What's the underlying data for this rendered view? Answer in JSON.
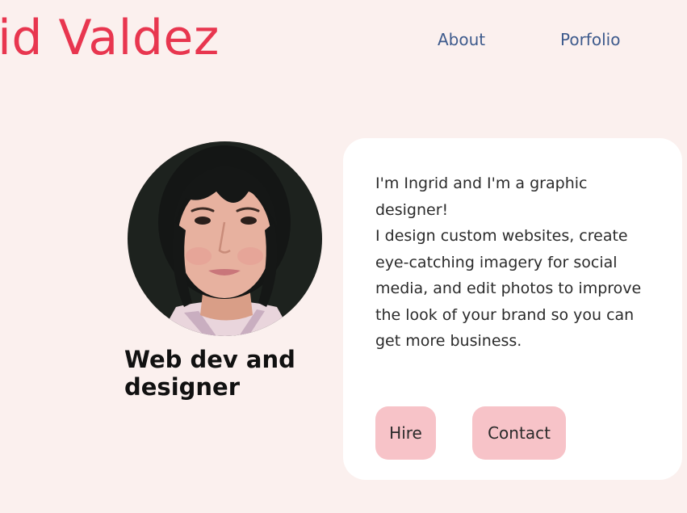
{
  "header": {
    "brand_name": "rid Valdez",
    "brand_color": "#e8364f",
    "nav": [
      {
        "label": "About"
      },
      {
        "label": "Porfolio"
      }
    ]
  },
  "profile": {
    "avatar_alt": "portrait photo",
    "tagline": "Web dev and designer"
  },
  "card": {
    "intro_line": "I'm Ingrid and I'm a graphic designer!",
    "description": "I design custom websites, create eye-catching imagery for social media, and edit photos to improve the look of your brand so you can get more business.",
    "buttons": {
      "hire_label": "Hire",
      "contact_label": "Contact"
    }
  },
  "colors": {
    "background": "#fbf0ee",
    "nav_link": "#3d5a8c",
    "button_bg": "#f7c3c8",
    "card_bg": "#ffffff"
  }
}
